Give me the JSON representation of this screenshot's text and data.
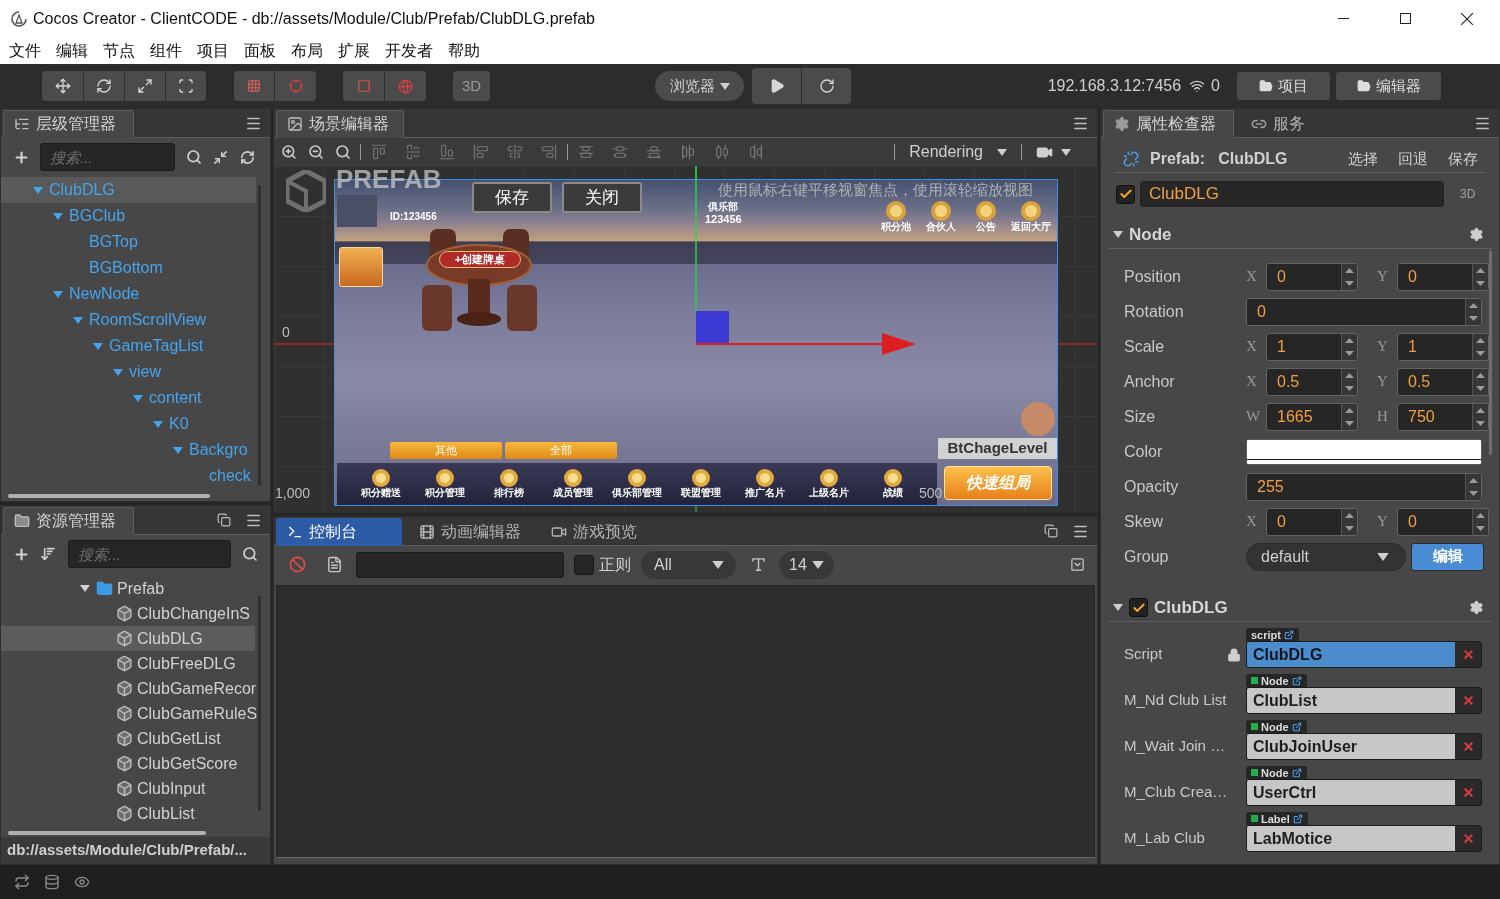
{
  "window": {
    "title": "Cocos Creator - ClientCODE - db://assets/Module/Club/Prefab/ClubDLG.prefab"
  },
  "menu": [
    "文件",
    "编辑",
    "节点",
    "组件",
    "项目",
    "面板",
    "布局",
    "扩展",
    "开发者",
    "帮助"
  ],
  "toolbar": {
    "view_mode": "3D",
    "preview_target": "浏览器",
    "server": "192.168.3.12:7456",
    "clients": "0",
    "buttons": [
      "项目",
      "编辑器"
    ]
  },
  "hierarchy": {
    "title": "层级管理器",
    "search": {
      "placeholder": "搜索..."
    },
    "tree": [
      {
        "label": "ClubDLG",
        "expanded": true,
        "selected": true,
        "children": [
          {
            "label": "BGClub",
            "expanded": true,
            "selected": false,
            "children": [
              {
                "label": "BGTop",
                "selected": false
              },
              {
                "label": "BGBottom",
                "selected": false
              }
            ]
          },
          {
            "label": "NewNode",
            "expanded": true,
            "selected": false,
            "children": [
              {
                "label": "RoomScrollView",
                "expanded": true,
                "selected": false,
                "children": [
                  {
                    "label": "GameTagList",
                    "expanded": true,
                    "selected": false,
                    "children": [
                      {
                        "label": "view",
                        "expanded": true,
                        "selected": false,
                        "children": [
                          {
                            "label": "content",
                            "expanded": true,
                            "selected": false,
                            "children": [
                              {
                                "label": "K0",
                                "expanded": true,
                                "selected": false,
                                "children": [
                                  {
                                    "label": "Backgro",
                                    "expanded": true,
                                    "selected": false,
                                    "children": [
                                      {
                                        "label": "check",
                                        "selected": false
                                      }
                                    ]
                                  }
                                ]
                              }
                            ]
                          }
                        ]
                      }
                    ]
                  }
                ]
              }
            ]
          }
        ]
      }
    ]
  },
  "assets": {
    "title": "资源管理器",
    "search": {
      "placeholder": "搜索..."
    },
    "tree": [
      {
        "label": "Prefab",
        "kind": "folder",
        "expanded": true,
        "selected": false,
        "children": [
          {
            "label": "ClubChangeInS",
            "kind": "prefab",
            "selected": false
          },
          {
            "label": "ClubDLG",
            "kind": "prefab",
            "selected": true
          },
          {
            "label": "ClubFreeDLG",
            "kind": "prefab",
            "selected": false
          },
          {
            "label": "ClubGameRecor",
            "kind": "prefab",
            "selected": false
          },
          {
            "label": "ClubGameRuleS",
            "kind": "prefab",
            "selected": false
          },
          {
            "label": "ClubGetList",
            "kind": "prefab",
            "selected": false
          },
          {
            "label": "ClubGetScore",
            "kind": "prefab",
            "selected": false
          },
          {
            "label": "ClubInput",
            "kind": "prefab",
            "selected": false
          },
          {
            "label": "ClubList",
            "kind": "prefab",
            "selected": false
          }
        ]
      }
    ],
    "path": "db://assets/Module/Club/Prefab/..."
  },
  "scene": {
    "title": "场景编辑器",
    "render_mode": "Rendering",
    "mode_badge": "PREFAB",
    "hint": "使用鼠标右键平移视窗焦点，使用滚轮缩放视图",
    "vertical_ruler": [
      "0"
    ],
    "horizontal_ruler": [
      "1,000",
      "500"
    ],
    "game_view": {
      "player_id": "ID:123456",
      "buttons": [
        "保存",
        "关闭"
      ],
      "club_title": "俱乐部",
      "club_id": "123456",
      "top_actions": [
        "积分池",
        "合伙人",
        "公告",
        "返回大厅"
      ],
      "table_sign": "+创建牌桌",
      "filters": [
        "其他",
        "全部"
      ],
      "bottom_actions": [
        "积分赠送",
        "积分管理",
        "排行榜",
        "成员管理",
        "俱乐部管理",
        "联盟管理",
        "推广名片",
        "上级名片",
        "战绩"
      ],
      "level_label": "BtChageLevel",
      "quick_start": "快速组局"
    }
  },
  "console": {
    "tabs": [
      {
        "label": "控制台",
        "kind": "console",
        "selected": true
      },
      {
        "label": "动画编辑器",
        "kind": "animation",
        "selected": false
      },
      {
        "label": "游戏预览",
        "kind": "preview",
        "selected": false
      }
    ],
    "filter": {
      "regex": false,
      "regex_label": "正则",
      "level": "All",
      "font_size": "14"
    }
  },
  "inspector": {
    "tabs": [
      {
        "label": "属性检查器",
        "kind": "properties",
        "selected": true
      },
      {
        "label": "服务",
        "kind": "services",
        "selected": false
      }
    ],
    "prefab": {
      "label": "Prefab:",
      "name": "ClubDLG",
      "actions": [
        "选择",
        "回退",
        "保存"
      ]
    },
    "node": {
      "active": true,
      "name": "ClubDLG",
      "badge": "3D"
    },
    "sections": [
      {
        "kind": "node",
        "title": "Node",
        "expanded": true,
        "properties": [
          {
            "kind": "pair",
            "label": "Position",
            "fields": [
              {
                "axis": "X",
                "value": "0"
              },
              {
                "axis": "Y",
                "value": "0"
              }
            ]
          },
          {
            "kind": "number",
            "label": "Rotation",
            "value": "0"
          },
          {
            "kind": "pair",
            "label": "Scale",
            "fields": [
              {
                "axis": "X",
                "value": "1"
              },
              {
                "axis": "Y",
                "value": "1"
              }
            ]
          },
          {
            "kind": "pair",
            "label": "Anchor",
            "fields": [
              {
                "axis": "X",
                "value": "0.5"
              },
              {
                "axis": "Y",
                "value": "0.5"
              }
            ]
          },
          {
            "kind": "pair",
            "label": "Size",
            "fields": [
              {
                "axis": "W",
                "value": "1665"
              },
              {
                "axis": "H",
                "value": "750"
              }
            ]
          },
          {
            "kind": "color",
            "label": "Color",
            "color": "#ffffff"
          },
          {
            "kind": "number",
            "label": "Opacity",
            "value": "255"
          },
          {
            "kind": "pair",
            "label": "Skew",
            "fields": [
              {
                "axis": "X",
                "value": "0"
              },
              {
                "axis": "Y",
                "value": "0"
              }
            ]
          },
          {
            "kind": "select",
            "label": "Group",
            "value": "default",
            "button": "编辑"
          }
        ]
      },
      {
        "kind": "component",
        "title": "ClubDLG",
        "enabled": true,
        "expanded": true,
        "properties": [
          {
            "kind": "script",
            "label": "Script",
            "locked": true,
            "ref_type": "script",
            "value": "ClubDLG"
          },
          {
            "kind": "reference",
            "label": "M_Nd Club List",
            "locked": false,
            "ref_type": "Node",
            "value": "ClubList"
          },
          {
            "kind": "reference",
            "label": "M_Wait Join …",
            "locked": false,
            "ref_type": "Node",
            "value": "ClubJoinUser"
          },
          {
            "kind": "reference",
            "label": "M_Club Crea…",
            "locked": false,
            "ref_type": "Node",
            "value": "UserCtrl"
          },
          {
            "kind": "reference",
            "label": "M_Lab Club",
            "locked": false,
            "ref_type": "Label",
            "value": "LabMotice"
          }
        ]
      }
    ]
  }
}
